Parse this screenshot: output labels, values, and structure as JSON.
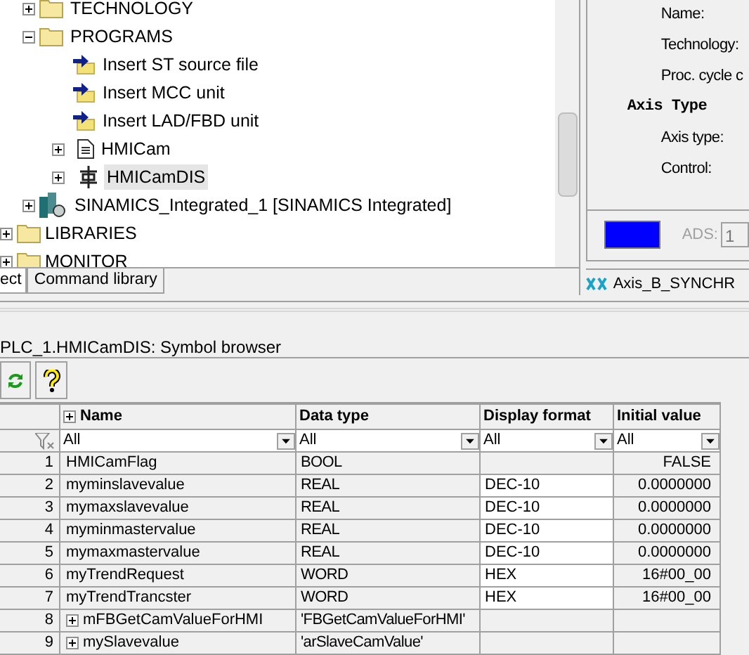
{
  "tree": [
    {
      "label": "TECHNOLOGY",
      "kind": "folder",
      "expanded": false
    },
    {
      "label": "PROGRAMS",
      "kind": "folder",
      "expanded": true,
      "children": [
        {
          "label": "Insert ST source file",
          "kind": "insert",
          "selected": false
        },
        {
          "label": "Insert MCC unit",
          "kind": "insert",
          "selected": false
        },
        {
          "label": "Insert LAD/FBD unit",
          "kind": "insert",
          "selected": false
        },
        {
          "label": "HMICam",
          "kind": "source",
          "expanded": false,
          "selected": false
        },
        {
          "label": "HMICamDIS",
          "kind": "unit",
          "expanded": false,
          "selected": true
        }
      ]
    },
    {
      "label": "SINAMICS_Integrated_1 [SINAMICS Integrated]",
      "kind": "drive",
      "expanded": false
    }
  ],
  "root_items": [
    {
      "label": "LIBRARIES",
      "expanded": false
    },
    {
      "label": "MONITOR",
      "expanded": false
    }
  ],
  "left_tabs": [
    {
      "label": "ect",
      "selected": true
    },
    {
      "label": "Command library",
      "selected": false
    }
  ],
  "properties": {
    "fields": [
      "Name:",
      "Technology:",
      "Proc. cycle c"
    ],
    "heading": "Axis Type",
    "axis_fields": [
      "Axis type:",
      "Control:"
    ],
    "ads_label": "ADS:",
    "ads_value": "1"
  },
  "right_tab": {
    "label": "Axis_B_SYNCHR"
  },
  "panel_title": "PLC_1.HMICamDIS: Symbol browser",
  "table": {
    "columns": [
      "Name",
      "Data type",
      "Display format",
      "Initial value"
    ],
    "filters": [
      "All",
      "All",
      "All",
      "All"
    ],
    "rows": [
      {
        "n": "1",
        "name": "HMICamFlag",
        "type": "BOOL",
        "format": "",
        "value": "FALSE",
        "kind": "simple"
      },
      {
        "n": "2",
        "name": "myminslavevalue",
        "type": "REAL",
        "format": "DEC-10",
        "value": "0.0000000",
        "kind": "simple"
      },
      {
        "n": "3",
        "name": "mymaxslavevalue",
        "type": "REAL",
        "format": "DEC-10",
        "value": "0.0000000",
        "kind": "simple"
      },
      {
        "n": "4",
        "name": "myminmastervalue",
        "type": "REAL",
        "format": "DEC-10",
        "value": "0.0000000",
        "kind": "simple"
      },
      {
        "n": "5",
        "name": "mymaxmastervalue",
        "type": "REAL",
        "format": "DEC-10",
        "value": "0.0000000",
        "kind": "simple"
      },
      {
        "n": "6",
        "name": "myTrendRequest",
        "type": "WORD",
        "format": "HEX",
        "value": "16#00_00",
        "kind": "simple"
      },
      {
        "n": "7",
        "name": "myTrendTrancster",
        "type": "WORD",
        "format": "HEX",
        "value": "16#00_00",
        "kind": "simple"
      },
      {
        "n": "8",
        "name": "mFBGetCamValueForHMI",
        "type": "'FBGetCamValueForHMI'",
        "format": "",
        "value": "",
        "kind": "struct"
      },
      {
        "n": "9",
        "name": "mySlavevalue",
        "type": "'arSlaveCamValue'",
        "format": "",
        "value": "",
        "kind": "struct"
      }
    ]
  }
}
